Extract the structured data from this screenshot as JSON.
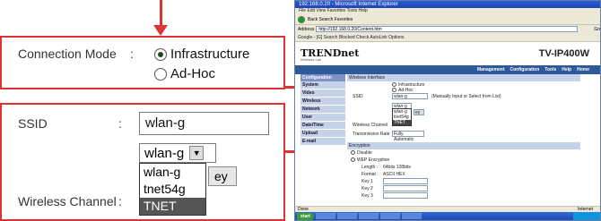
{
  "callout": {
    "connection_mode_label": "Connection Mode",
    "colon1": ":",
    "mode_options": [
      "Infrastructure",
      "Ad-Hoc"
    ],
    "selected_mode": "Infrastructure",
    "ssid_label": "SSID",
    "colon2": ":",
    "ssid_value": "wlan-g",
    "ssid_select_value": "wlan-g",
    "ssid_options": [
      "wlan-g",
      "tnet54g",
      "TNET"
    ],
    "highlighted_option": "TNET",
    "button_partial": "ey",
    "wireless_channel_label": "Wireless Channel",
    "colon3": ":"
  },
  "browser": {
    "title": "192.168.0.20 - Microsoft Internet Explorer",
    "menu": "File  Edit  View  Favorites  Tools  Help",
    "toolbar_text": "Back  Search  Favorites",
    "address_label": "Address",
    "address": "http://192.168.0.20/Content.htm",
    "go": "Go",
    "google_bar": "Google - [G]   Search  Blocked  Check  AutoLink  Options",
    "brand": "TRENDnet",
    "brand_sub": "Wireless Lab",
    "model": "TV-IP400W",
    "nav": [
      "Management",
      "Configuration",
      "Tools",
      "Help",
      "Home"
    ],
    "sidebar_header": "Configuration",
    "sidebar_items": [
      "System",
      "Video",
      "Wireless",
      "Network",
      "User",
      "Date/Time",
      "Upload",
      "E-mail"
    ],
    "wireless_section": "Wireless Interface",
    "mode_options": [
      "Infrastructure",
      "Ad-Hoc"
    ],
    "ssid_label": "SSID",
    "ssid_value": "wlan-g",
    "ssid_hint": "(Manually Input or Select from List)",
    "mini_list": [
      "wlan-g",
      "tnet54g",
      "TNET"
    ],
    "mini_button": "ey",
    "channel_label": "Wireless Channel",
    "rate_label": "Transmission Rate",
    "rate_value": "Fully Automatic",
    "encryption_section": "Encryption",
    "enc_disable": "Disable",
    "enc_wep": "WEP Encryption",
    "length_label": "Length :",
    "length_opts": "64bits  128bits",
    "format_label": "Format :",
    "format_opts": "ASCII  HEX",
    "keys": [
      "Key 1",
      "Key 2",
      "Key 3",
      "Key 4"
    ],
    "status": "Done",
    "status_right": "Internet",
    "start": "start"
  },
  "colors": {
    "accent": "#dd3333",
    "nav": "#2f5a9a",
    "sidebar": "#c6d1ea"
  }
}
